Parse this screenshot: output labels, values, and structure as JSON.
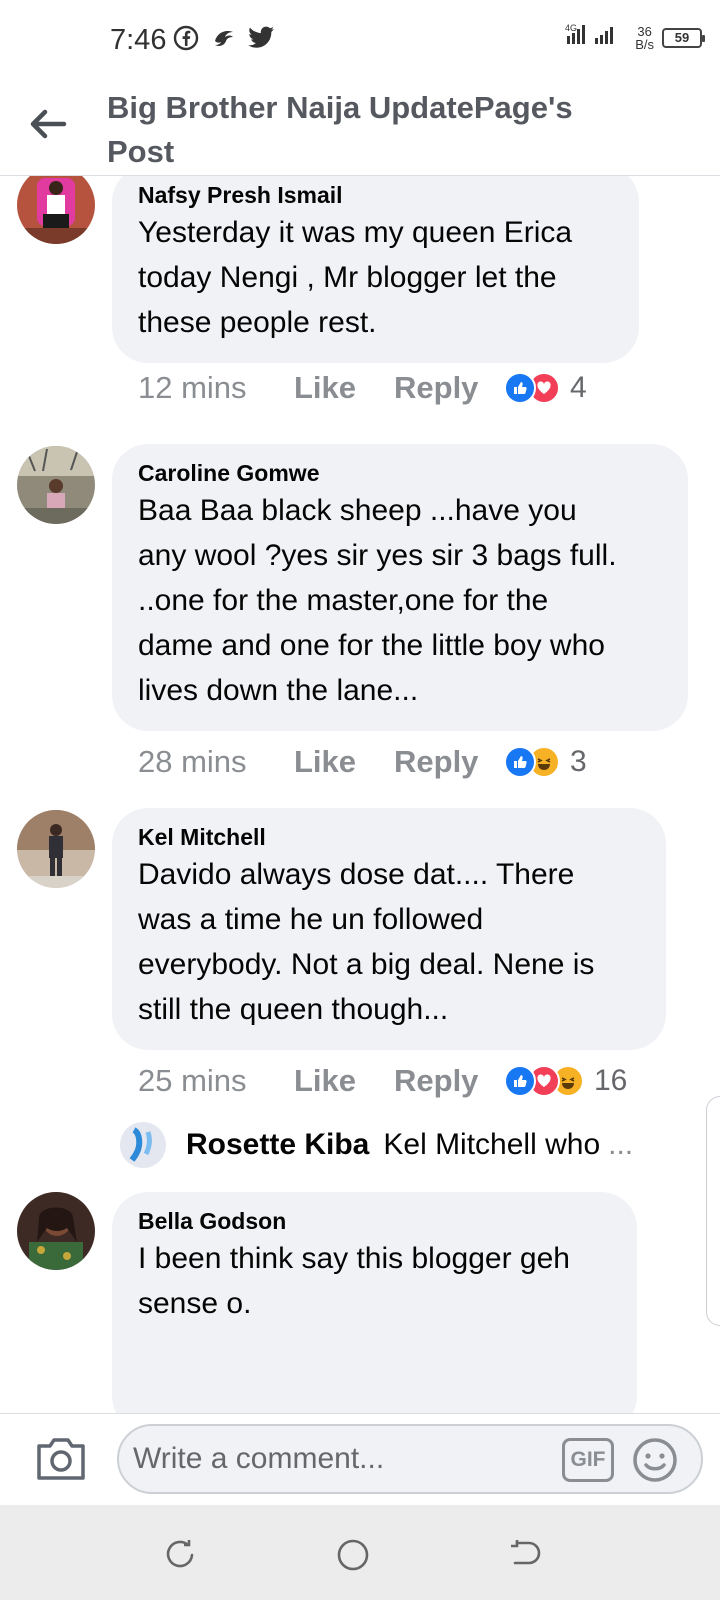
{
  "status_bar": {
    "time": "7:46",
    "net_speed_value": "36",
    "net_speed_unit": "B/s",
    "battery": "59",
    "icons": [
      "facebook-icon",
      "app-icon",
      "twitter-icon",
      "signal-icon",
      "battery-icon"
    ]
  },
  "header": {
    "title": "Big Brother Naija UpdatePage's Post"
  },
  "comments": [
    {
      "author": "Nafsy Presh Ismail",
      "text": "Yesterday it was my queen Erica\ntoday Nengi , Mr blogger let the\nthese people rest.",
      "time": "12 mins",
      "like_label": "Like",
      "reply_label": "Reply",
      "reactions": [
        "like",
        "love"
      ],
      "reaction_count": "4"
    },
    {
      "author": "Caroline Gomwe",
      "text": "Baa Baa black sheep ...have you\nany wool ?yes sir yes sir 3 bags full.\n..one for the master,one for the\ndame and one for the little boy who\nlives down the lane...",
      "time": "28 mins",
      "like_label": "Like",
      "reply_label": "Reply",
      "reactions": [
        "like",
        "haha"
      ],
      "reaction_count": "3"
    },
    {
      "author": "Kel Mitchell",
      "text": "Davido always dose dat.... There\nwas a time he un followed\neverybody. Not a big deal.  Nene is\nstill the queen though...",
      "time": "25 mins",
      "like_label": "Like",
      "reply_label": "Reply",
      "reactions": [
        "like",
        "love",
        "haha"
      ],
      "reaction_count": "16",
      "reply_preview": {
        "author": "Rosette Kiba",
        "text": "Kel Mitchell who",
        "ellipsis": "..."
      }
    },
    {
      "author": "Bella Godson",
      "text": "I been think say this blogger geh\nsense o."
    }
  ],
  "composer": {
    "placeholder": "Write a comment...",
    "gif_label": "GIF"
  },
  "colors": {
    "bubble": "#f0f2f5",
    "meta_text": "#8a8d91",
    "like_blue": "#1877f2",
    "love_red": "#f33e58",
    "haha_yellow": "#f7b125"
  }
}
